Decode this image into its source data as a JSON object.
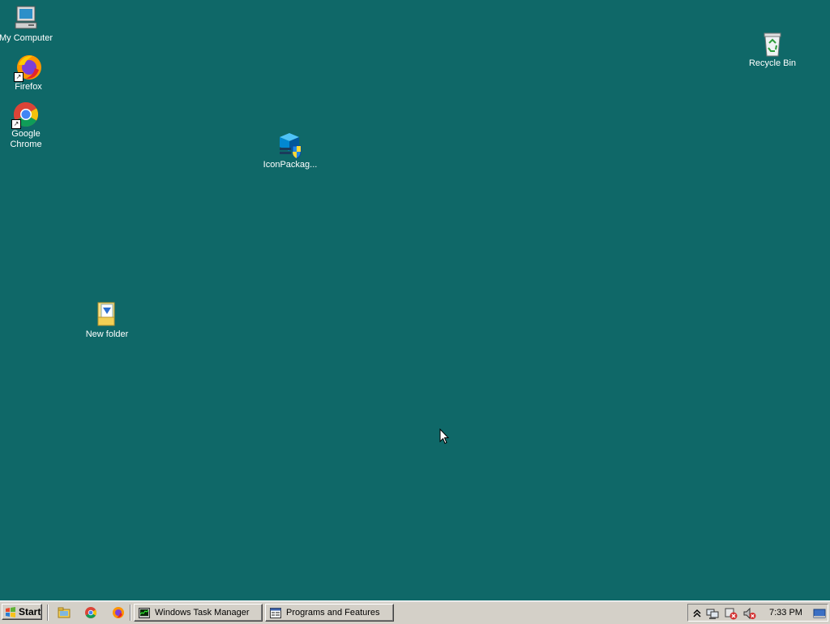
{
  "desktop": {
    "icons": {
      "my_computer": "My Computer",
      "firefox": "Firefox",
      "chrome_line1": "Google",
      "chrome_line2": "Chrome",
      "iconpackager": "IconPackag...",
      "new_folder": "New folder",
      "recycle_bin": "Recycle Bin"
    }
  },
  "taskbar": {
    "start_label": "Start",
    "quick_launch": [
      "explorer-icon",
      "chrome-icon",
      "firefox-icon"
    ],
    "tasks": [
      {
        "label": "Windows Task Manager",
        "icon": "task-manager-icon"
      },
      {
        "label": "Programs and Features",
        "icon": "programs-features-icon"
      }
    ],
    "tray": {
      "icons": [
        "show-hidden-icons-arrow",
        "network-icon",
        "security-alert-icon",
        "volume-muted-icon"
      ],
      "clock": "7:33 PM"
    }
  },
  "colors": {
    "desktop_background": "#0f6868",
    "taskbar": "#d4d0c8"
  }
}
